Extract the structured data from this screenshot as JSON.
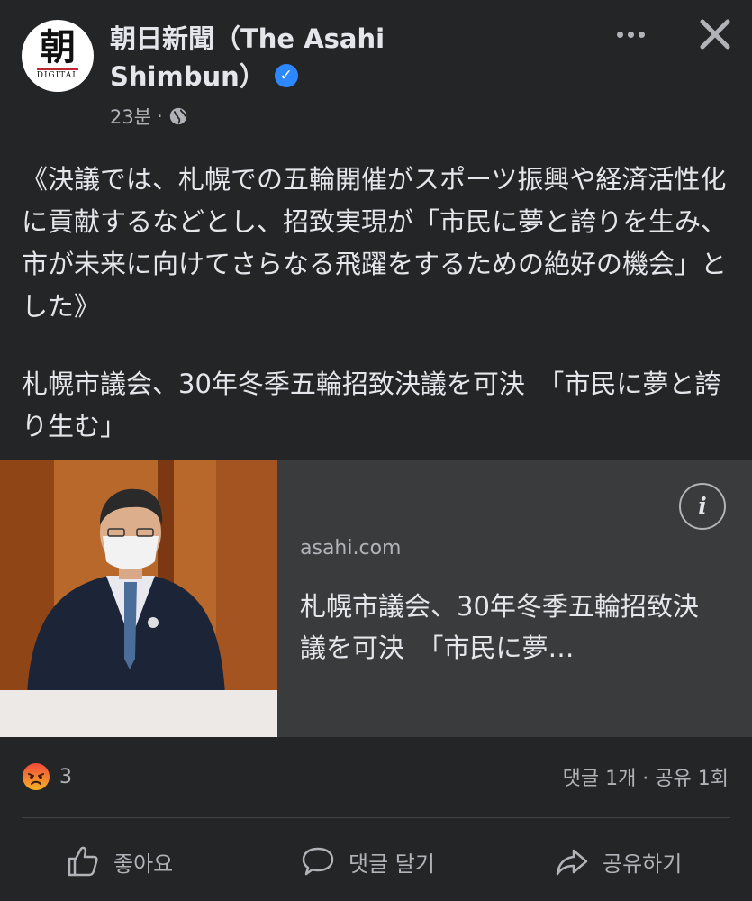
{
  "post": {
    "page_name": "朝日新聞（The Asahi Shimbun）",
    "avatar": {
      "glyph": "朝",
      "sub": "DIGITAL"
    },
    "time": "23분",
    "separator": "·",
    "text": "《決議では、札幌での五輪開催がスポーツ振興や経済活性化に貢献するなどとし、招致実現が「市民に夢と誇りを生み、市が未来に向けてさらなる飛躍をするための絶好の機会」とした》",
    "headline": "札幌市議会、30年冬季五輪招致決議を可決　「市民に夢と誇り生む」"
  },
  "link_preview": {
    "domain": "asahi.com",
    "title": "札幌市議会、30年冬季五輪招致決議を可決　「市民に夢…",
    "info_glyph": "i"
  },
  "engagement": {
    "reaction_count": "3",
    "comments_shares": "댓글 1개 · 공유 1회"
  },
  "actions": {
    "like": "좋아요",
    "comment": "댓글 달기",
    "share": "공유하기"
  },
  "icons": [
    "verified-badge-icon",
    "globe-icon",
    "more-icon",
    "close-icon",
    "info-icon",
    "angry-reaction-icon",
    "like-icon",
    "comment-icon",
    "share-icon"
  ],
  "colors": {
    "background": "#242526",
    "card": "#3a3b3c",
    "text": "#e4e6eb",
    "muted": "#b0b3b8",
    "verified": "#2d88ff"
  }
}
